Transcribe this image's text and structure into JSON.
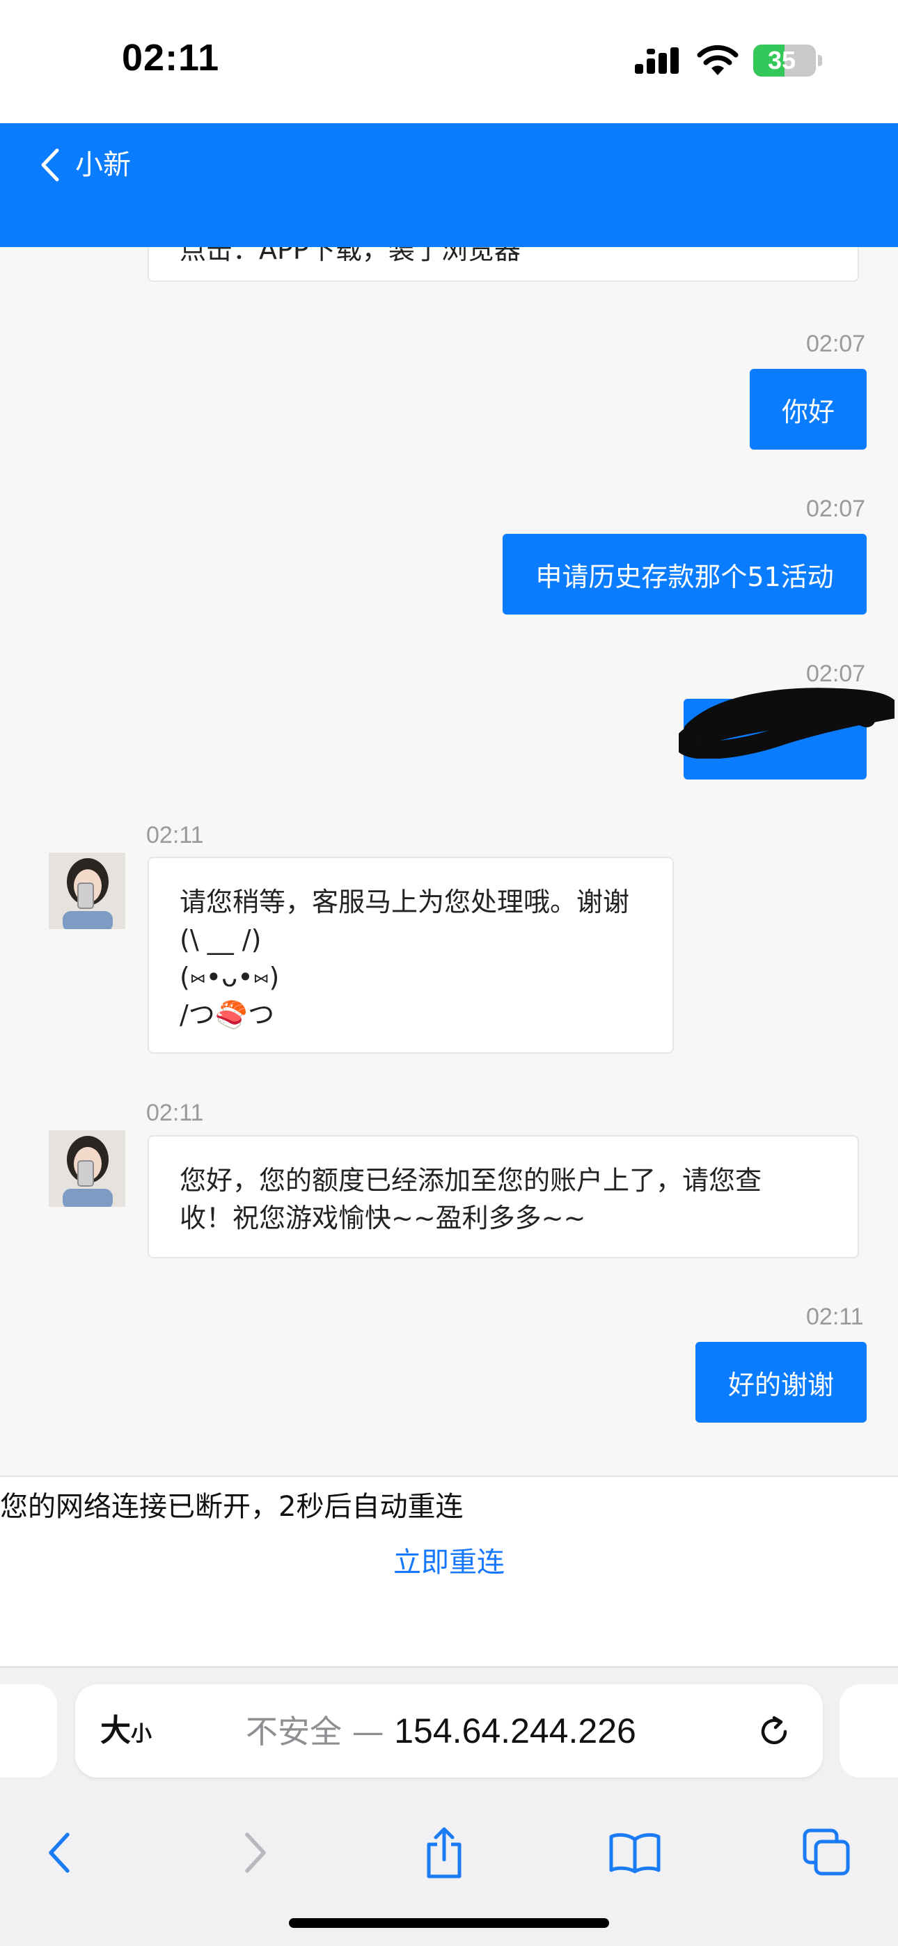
{
  "status_bar": {
    "time": "02:11",
    "battery_level": "35",
    "icons": [
      "signal-icon",
      "wifi-icon",
      "battery-charging-icon"
    ]
  },
  "header": {
    "title": "小新",
    "back_icon": "chevron-left-icon",
    "background_color": "#0a7cff"
  },
  "chat": {
    "partial_message": "点击：APP下载，装了浏览器",
    "messages": [
      {
        "direction": "out",
        "time": "02:07",
        "text": "你好"
      },
      {
        "direction": "out",
        "time": "02:07",
        "text": "申请历史存款那个51活动"
      },
      {
        "direction": "out",
        "time": "02:07",
        "text": "",
        "redacted": true
      },
      {
        "direction": "in",
        "time": "02:11",
        "lines": [
          "请您稍等，客服马上为您处理哦。谢谢",
          "(\\ __ /)",
          "(⑅•ᴗ•⑅)",
          "/つ🍣つ"
        ]
      },
      {
        "direction": "in",
        "time": "02:11",
        "lines": [
          "您好，您的额度已经添加至您的账户上了，请您查",
          "收！祝您游戏愉快~~盈利多多~~"
        ]
      },
      {
        "direction": "out",
        "time": "02:11",
        "text": "好的谢谢"
      }
    ],
    "outgoing_color": "#0a7cff"
  },
  "notice": {
    "text": "您的网络连接已断开，2秒后自动重连",
    "reconnect_label": "立即重连",
    "link_color": "#1677ff"
  },
  "browser": {
    "text_size_big": "大",
    "text_size_small": "小",
    "insecure_label": "不安全 — ",
    "host": "154.64.244.226",
    "toolbar_icons": [
      "back-icon",
      "forward-icon",
      "share-icon",
      "bookmarks-icon",
      "tabs-icon"
    ]
  }
}
